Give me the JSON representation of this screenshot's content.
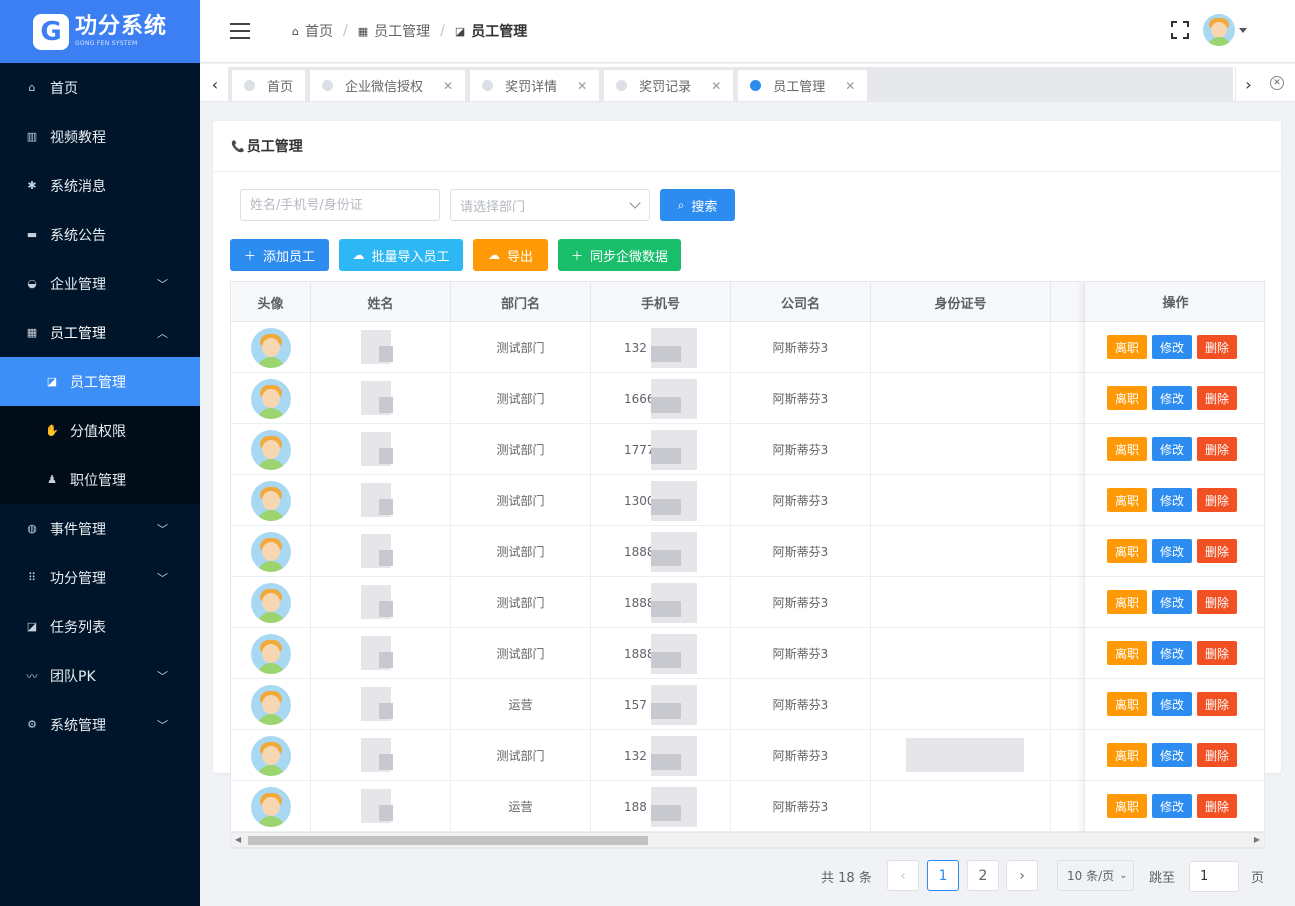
{
  "app": {
    "logo_mark": "G",
    "logo_title": "功分系统",
    "logo_subtitle": "GONG FEN SYSTEM"
  },
  "sidebar": {
    "items": [
      {
        "label": "首页",
        "icon": "home-icon",
        "glyph": "⌂"
      },
      {
        "label": "视频教程",
        "icon": "book-icon",
        "glyph": "▥"
      },
      {
        "label": "系统消息",
        "icon": "asterisk-icon",
        "glyph": "✱"
      },
      {
        "label": "系统公告",
        "icon": "card-icon",
        "glyph": "▬"
      },
      {
        "label": "企业管理",
        "icon": "car-icon",
        "glyph": "◒",
        "has_children": true
      },
      {
        "label": "员工管理",
        "icon": "grid-icon",
        "glyph": "▦",
        "has_children": true,
        "open": true
      },
      {
        "label": "事件管理",
        "icon": "globe-icon",
        "glyph": "◍",
        "has_children": true
      },
      {
        "label": "功分管理",
        "icon": "dots-grid-icon",
        "glyph": "⠿",
        "has_children": true
      },
      {
        "label": "任务列表",
        "icon": "chart-icon",
        "glyph": "◪"
      },
      {
        "label": "团队PK",
        "icon": "trend-icon",
        "glyph": "〰",
        "has_children": true
      },
      {
        "label": "系统管理",
        "icon": "gear-icon",
        "glyph": "⚙",
        "has_children": true
      }
    ],
    "subitems": [
      {
        "label": "员工管理",
        "icon": "chart-icon",
        "glyph": "◪",
        "active": true
      },
      {
        "label": "分值权限",
        "icon": "hand-icon",
        "glyph": "✋"
      },
      {
        "label": "职位管理",
        "icon": "user-icon",
        "glyph": "♟"
      }
    ]
  },
  "header": {
    "breadcrumb": [
      {
        "label": "首页",
        "icon": "home-icon",
        "glyph": "⌂"
      },
      {
        "label": "员工管理",
        "icon": "grid-icon",
        "glyph": "▦"
      },
      {
        "label": "员工管理",
        "icon": "chart-icon",
        "glyph": "◪"
      }
    ],
    "separator": "/"
  },
  "tabs": [
    {
      "label": "首页",
      "closable": false,
      "active": false
    },
    {
      "label": "企业微信授权",
      "closable": true,
      "active": false
    },
    {
      "label": "奖罚详情",
      "closable": true,
      "active": false
    },
    {
      "label": "奖罚记录",
      "closable": true,
      "active": false
    },
    {
      "label": "员工管理",
      "closable": true,
      "active": true
    }
  ],
  "page": {
    "title": "员工管理",
    "title_icon": "phone-icon"
  },
  "filters": {
    "search_placeholder": "姓名/手机号/身份证",
    "search_value": "",
    "department_placeholder": "请选择部门",
    "search_button": "搜索"
  },
  "actions": {
    "add": "添加员工",
    "import": "批量导入员工",
    "export": "导出",
    "sync": "同步企微数据"
  },
  "colors": {
    "primary": "#2d8cf0",
    "cyan": "#2db7f5",
    "orange": "#ff9a06",
    "green": "#19be6b",
    "red": "#f05022",
    "sidebar": "#001529"
  },
  "table": {
    "columns": [
      "头像",
      "姓名",
      "部门名",
      "手机号",
      "公司名",
      "身份证号",
      "",
      "操作"
    ],
    "row_actions": {
      "leave": "离职",
      "edit": "修改",
      "delete": "删除"
    },
    "rows": [
      {
        "department": "测试部门",
        "phone": "132",
        "company": "阿斯蒂芬3"
      },
      {
        "department": "测试部门",
        "phone": "1666",
        "company": "阿斯蒂芬3"
      },
      {
        "department": "测试部门",
        "phone": "1777",
        "company": "阿斯蒂芬3"
      },
      {
        "department": "测试部门",
        "phone": "1300",
        "company": "阿斯蒂芬3"
      },
      {
        "department": "测试部门",
        "phone": "1888",
        "company": "阿斯蒂芬3"
      },
      {
        "department": "测试部门",
        "phone": "1888",
        "company": "阿斯蒂芬3"
      },
      {
        "department": "测试部门",
        "phone": "1888",
        "company": "阿斯蒂芬3"
      },
      {
        "department": "运营",
        "phone": "157",
        "company": "阿斯蒂芬3"
      },
      {
        "department": "测试部门",
        "phone": "132",
        "company": "阿斯蒂芬3"
      },
      {
        "department": "运营",
        "phone": "188",
        "company": "阿斯蒂芬3"
      }
    ]
  },
  "pagination": {
    "total_text": "共 18 条",
    "pages": [
      "1",
      "2"
    ],
    "current": "1",
    "page_size": "10 条/页",
    "jump_label": "跳至",
    "jump_value": "1",
    "page_label": "页"
  }
}
